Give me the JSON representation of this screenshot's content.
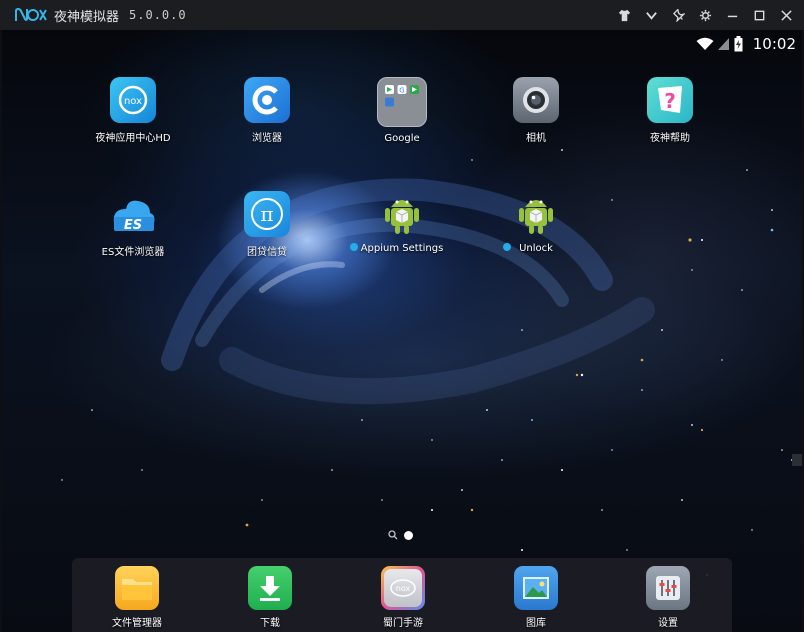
{
  "window": {
    "title": "夜神模拟器",
    "version": "5.0.0.0",
    "controls": [
      "shirt-icon",
      "chevron-down-icon",
      "pin-icon",
      "gear-icon",
      "minimize-icon",
      "maximize-icon",
      "close-icon"
    ]
  },
  "status": {
    "time": "10:02"
  },
  "apps": [
    {
      "label": "夜神应用中心HD",
      "icon": "nox-app-center-icon"
    },
    {
      "label": "浏览器",
      "icon": "browser-icon"
    },
    {
      "label": "Google",
      "icon": "google-folder-icon"
    },
    {
      "label": "相机",
      "icon": "camera-icon"
    },
    {
      "label": "夜神帮助",
      "icon": "help-icon"
    },
    {
      "label": "ES文件浏览器",
      "icon": "es-file-explorer-icon"
    },
    {
      "label": "团贷信贷",
      "icon": "pi-finance-icon"
    },
    {
      "label": "Appium Settings",
      "icon": "android-robot-icon"
    },
    {
      "label": "Unlock",
      "icon": "android-robot-icon"
    }
  ],
  "dock": [
    {
      "label": "文件管理器",
      "icon": "folder-icon"
    },
    {
      "label": "下载",
      "icon": "download-icon"
    },
    {
      "label": "蜀门手游",
      "icon": "game-icon"
    },
    {
      "label": "图库",
      "icon": "gallery-icon"
    },
    {
      "label": "设置",
      "icon": "settings-icon"
    }
  ],
  "colors": {
    "titlebar": "#1b1d20",
    "accent": "#22aee8"
  }
}
